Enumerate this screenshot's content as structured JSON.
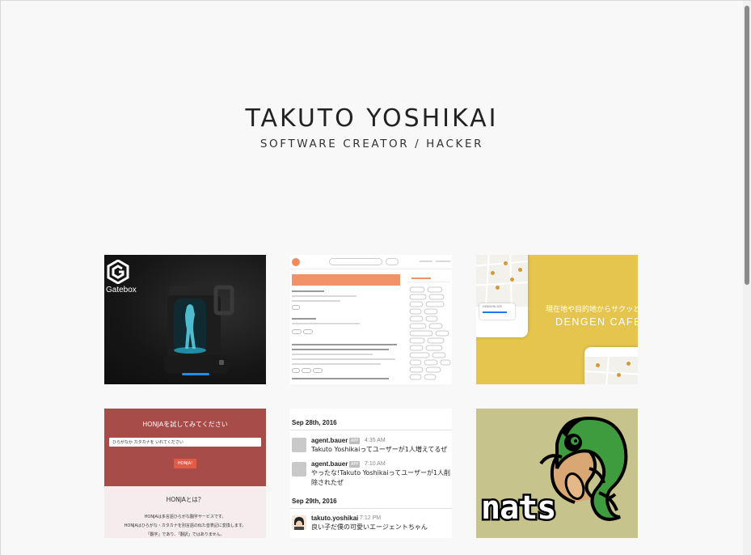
{
  "header": {
    "title": "TAKUTO YOSHIKAI",
    "subtitle": "SOFTWARE CREATOR / HACKER"
  },
  "projects": [
    {
      "name": "gatebox",
      "logo_text": "Gatebox",
      "icon": "gatebox-logo-icon"
    },
    {
      "name": "qiita-like-site",
      "icon": "site-screenshot"
    },
    {
      "name": "dengen-cafe",
      "tagline": "現在地や目的地からサクッと探せる",
      "logo_text": "DENGEN CAFE",
      "phone_label": "DENGENCAFE"
    },
    {
      "name": "honja",
      "title": "HONJAを試してみてください",
      "input_value": "ひらがなか カタカナを いれてください",
      "button_label": "HONJA!",
      "about_title": "HONJAとは？",
      "about_lines": [
        "HONJAは多言語ひらがな翻字サービスです。",
        "HONJAはひらがな・カタカナを別言語の似た音表記に変換します。",
        "「翻字」であり、「翻訳」ではありません。"
      ]
    },
    {
      "name": "slack-bot",
      "days": [
        {
          "date": "Sep 28th, 2016",
          "messages": [
            {
              "user": "agent.bauer",
              "badge": "APP",
              "time": "4:35 AM",
              "text": "Takuto Yoshikaiってユーザーが1人増えてるぜ"
            },
            {
              "user": "agent.bauer",
              "badge": "APP",
              "time": "7:10 AM",
              "text_lines": [
                "やったな!Takuto Yoshikaiってユーザーが1人削",
                "除されたぜ"
              ]
            }
          ]
        },
        {
          "date": "Sep 29th, 2016",
          "messages": [
            {
              "user": "takuto.yoshikai",
              "time": "7:12 PM",
              "text": "良い子だ僕の可愛いエージェントちゃん"
            }
          ]
        }
      ]
    },
    {
      "name": "nats",
      "logo_text": "nats"
    }
  ],
  "colors": {
    "background": "#f8f8f8",
    "gatebox_bg": "#161616",
    "qiita_accent": "#f2926a",
    "dengen_bg": "#e5c54e",
    "honja_red": "#a84c4a",
    "nats_bg": "#c6c38c",
    "nats_green": "#3f9c3e"
  }
}
